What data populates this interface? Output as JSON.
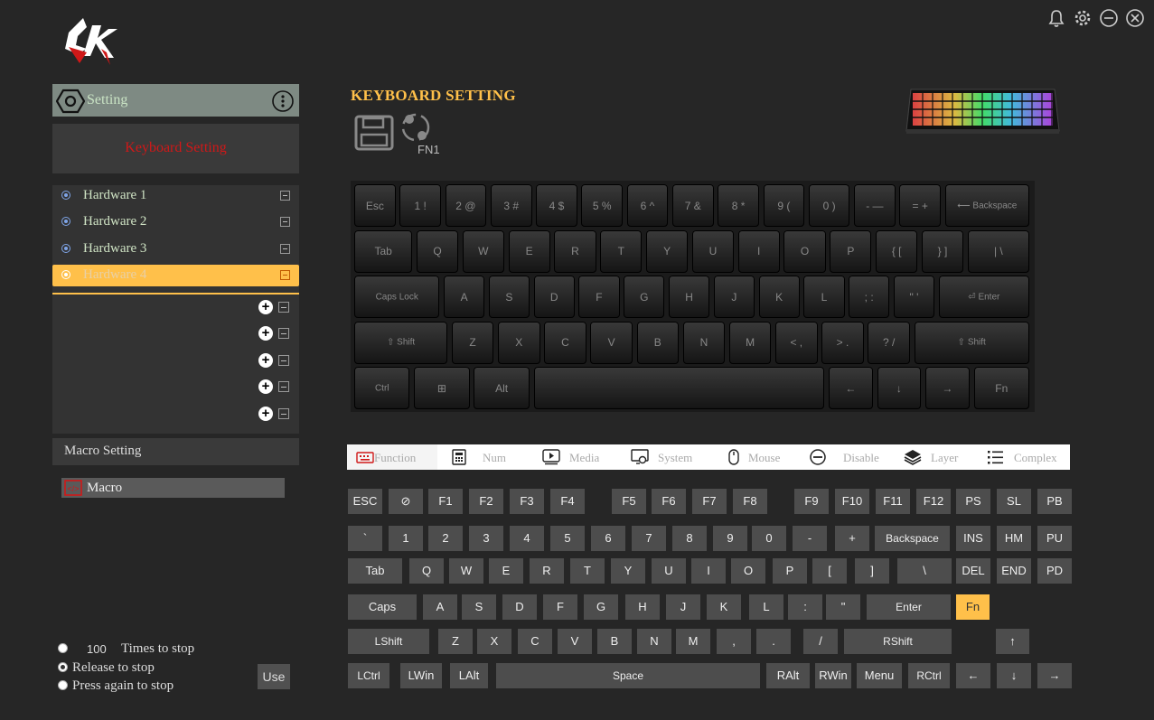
{
  "window": {
    "title_icons": [
      "bell-icon",
      "gear-icon",
      "minimize-icon",
      "close-icon"
    ]
  },
  "sidebar": {
    "setting_label": "Setting",
    "keyboard_setting_label": "Keyboard Setting",
    "hardware": [
      {
        "label": "Hardware  1"
      },
      {
        "label": "Hardware  2"
      },
      {
        "label": "Hardware  3"
      },
      {
        "label": "Hardware  4",
        "active": true
      }
    ],
    "macro_setting_label": "Macro Setting",
    "macro_item_label": "Macro",
    "repeat": {
      "count": "100",
      "times_label": "Times to stop",
      "release_label": "Release to stop",
      "press_again_label": "Press again to stop",
      "selected": "release"
    },
    "use_label": "Use"
  },
  "main": {
    "title": "KEYBOARD SETTING",
    "fn_label": "FN1",
    "accent": "#ffc04a"
  },
  "visual_keyboard": {
    "rows": [
      [
        "Esc",
        "1 !",
        "2 @",
        "3 #",
        "4 $",
        "5 %",
        "6 ^",
        "7 &",
        "8 *",
        "9 (",
        "0 )",
        "- —",
        "= +",
        "⟵ Backspace"
      ],
      [
        "Tab",
        "Q",
        "W",
        "E",
        "R",
        "T",
        "Y",
        "U",
        "I",
        "O",
        "P",
        "{ [",
        "} ]",
        "| \\"
      ],
      [
        "Caps Lock",
        "A",
        "S",
        "D",
        "F",
        "G",
        "H",
        "J",
        "K",
        "L",
        "; :",
        "\" '",
        "⏎ Enter"
      ],
      [
        "⇧ Shift",
        "Z",
        "X",
        "C",
        "V",
        "B",
        "N",
        "M",
        "< ,",
        "> .",
        "? /",
        "⇧ Shift"
      ],
      [
        "Ctrl",
        "⊞",
        "Alt",
        "",
        "←",
        "↓",
        "→",
        "Fn"
      ]
    ]
  },
  "tabs": [
    {
      "label": "Function",
      "icon": "keyboard-icon"
    },
    {
      "label": "Num",
      "icon": "calculator-icon"
    },
    {
      "label": "Media",
      "icon": "media-icon"
    },
    {
      "label": "System",
      "icon": "system-icon"
    },
    {
      "label": "Mouse",
      "icon": "mouse-icon"
    },
    {
      "label": "Disable",
      "icon": "disable-icon"
    },
    {
      "label": "Layer",
      "icon": "layer-icon"
    },
    {
      "label": "Complex",
      "icon": "list-icon"
    }
  ],
  "keys": {
    "row1": [
      "ESC",
      "⊘",
      "F1",
      "F2",
      "F3",
      "F4",
      "F5",
      "F6",
      "F7",
      "F8",
      "F9",
      "F10",
      "F11",
      "F12",
      "PS",
      "SL",
      "PB"
    ],
    "row2": [
      "`",
      "1",
      "2",
      "3",
      "4",
      "5",
      "6",
      "7",
      "8",
      "9",
      "0",
      "-",
      "+",
      "Backspace",
      "INS",
      "HM",
      "PU"
    ],
    "row3": [
      "Tab",
      "Q",
      "W",
      "E",
      "R",
      "T",
      "Y",
      "U",
      "I",
      "O",
      "P",
      "[",
      "]",
      "\\",
      "DEL",
      "END",
      "PD"
    ],
    "row4": [
      "Caps",
      "A",
      "S",
      "D",
      "F",
      "G",
      "H",
      "J",
      "K",
      "L",
      ":",
      "\"",
      "Enter",
      "Fn"
    ],
    "row5": [
      "LShift",
      "Z",
      "X",
      "C",
      "V",
      "B",
      "N",
      "M",
      ",",
      ".",
      "/",
      "RShift",
      "↑"
    ],
    "row6": [
      "LCtrl",
      "LWin",
      "LAlt",
      "Space",
      "RAlt",
      "RWin",
      "Menu",
      "RCtrl",
      "←",
      "↓",
      "→"
    ],
    "highlighted": "Fn"
  }
}
